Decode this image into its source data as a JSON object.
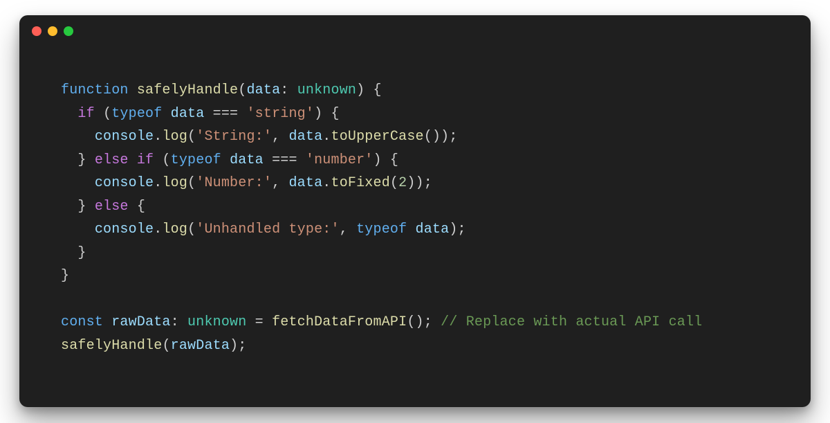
{
  "window": {
    "buttons": [
      "close",
      "minimize",
      "zoom"
    ]
  },
  "code": {
    "language": "typescript",
    "lines": [
      [
        {
          "c": "kw",
          "t": "function "
        },
        {
          "c": "fn",
          "t": "safelyHandle"
        },
        {
          "c": "pun",
          "t": "("
        },
        {
          "c": "id",
          "t": "data"
        },
        {
          "c": "pun",
          "t": ": "
        },
        {
          "c": "typ",
          "t": "unknown"
        },
        {
          "c": "pun",
          "t": ") {"
        }
      ],
      [
        {
          "c": "pun",
          "t": "  "
        },
        {
          "c": "ctl",
          "t": "if"
        },
        {
          "c": "pun",
          "t": " ("
        },
        {
          "c": "op",
          "t": "typeof"
        },
        {
          "c": "pun",
          "t": " "
        },
        {
          "c": "id",
          "t": "data"
        },
        {
          "c": "pun",
          "t": " === "
        },
        {
          "c": "str",
          "t": "'string'"
        },
        {
          "c": "pun",
          "t": ") {"
        }
      ],
      [
        {
          "c": "pun",
          "t": "    "
        },
        {
          "c": "id",
          "t": "console"
        },
        {
          "c": "pun",
          "t": "."
        },
        {
          "c": "fn",
          "t": "log"
        },
        {
          "c": "pun",
          "t": "("
        },
        {
          "c": "str",
          "t": "'String:'"
        },
        {
          "c": "pun",
          "t": ", "
        },
        {
          "c": "id",
          "t": "data"
        },
        {
          "c": "pun",
          "t": "."
        },
        {
          "c": "fn",
          "t": "toUpperCase"
        },
        {
          "c": "pun",
          "t": "());"
        }
      ],
      [
        {
          "c": "pun",
          "t": "  } "
        },
        {
          "c": "ctl",
          "t": "else if"
        },
        {
          "c": "pun",
          "t": " ("
        },
        {
          "c": "op",
          "t": "typeof"
        },
        {
          "c": "pun",
          "t": " "
        },
        {
          "c": "id",
          "t": "data"
        },
        {
          "c": "pun",
          "t": " === "
        },
        {
          "c": "str",
          "t": "'number'"
        },
        {
          "c": "pun",
          "t": ") {"
        }
      ],
      [
        {
          "c": "pun",
          "t": "    "
        },
        {
          "c": "id",
          "t": "console"
        },
        {
          "c": "pun",
          "t": "."
        },
        {
          "c": "fn",
          "t": "log"
        },
        {
          "c": "pun",
          "t": "("
        },
        {
          "c": "str",
          "t": "'Number:'"
        },
        {
          "c": "pun",
          "t": ", "
        },
        {
          "c": "id",
          "t": "data"
        },
        {
          "c": "pun",
          "t": "."
        },
        {
          "c": "fn",
          "t": "toFixed"
        },
        {
          "c": "pun",
          "t": "("
        },
        {
          "c": "num",
          "t": "2"
        },
        {
          "c": "pun",
          "t": "));"
        }
      ],
      [
        {
          "c": "pun",
          "t": "  } "
        },
        {
          "c": "ctl",
          "t": "else"
        },
        {
          "c": "pun",
          "t": " {"
        }
      ],
      [
        {
          "c": "pun",
          "t": "    "
        },
        {
          "c": "id",
          "t": "console"
        },
        {
          "c": "pun",
          "t": "."
        },
        {
          "c": "fn",
          "t": "log"
        },
        {
          "c": "pun",
          "t": "("
        },
        {
          "c": "str",
          "t": "'Unhandled type:'"
        },
        {
          "c": "pun",
          "t": ", "
        },
        {
          "c": "op",
          "t": "typeof"
        },
        {
          "c": "pun",
          "t": " "
        },
        {
          "c": "id",
          "t": "data"
        },
        {
          "c": "pun",
          "t": ");"
        }
      ],
      [
        {
          "c": "pun",
          "t": "  }"
        }
      ],
      [
        {
          "c": "pun",
          "t": "}"
        }
      ],
      [],
      [
        {
          "c": "kw",
          "t": "const "
        },
        {
          "c": "id",
          "t": "rawData"
        },
        {
          "c": "pun",
          "t": ": "
        },
        {
          "c": "typ",
          "t": "unknown"
        },
        {
          "c": "pun",
          "t": " = "
        },
        {
          "c": "fn",
          "t": "fetchDataFromAPI"
        },
        {
          "c": "pun",
          "t": "(); "
        },
        {
          "c": "cmt",
          "t": "// Replace with actual API call"
        }
      ],
      [
        {
          "c": "fn",
          "t": "safelyHandle"
        },
        {
          "c": "pun",
          "t": "("
        },
        {
          "c": "id",
          "t": "rawData"
        },
        {
          "c": "pun",
          "t": ");"
        }
      ]
    ]
  }
}
